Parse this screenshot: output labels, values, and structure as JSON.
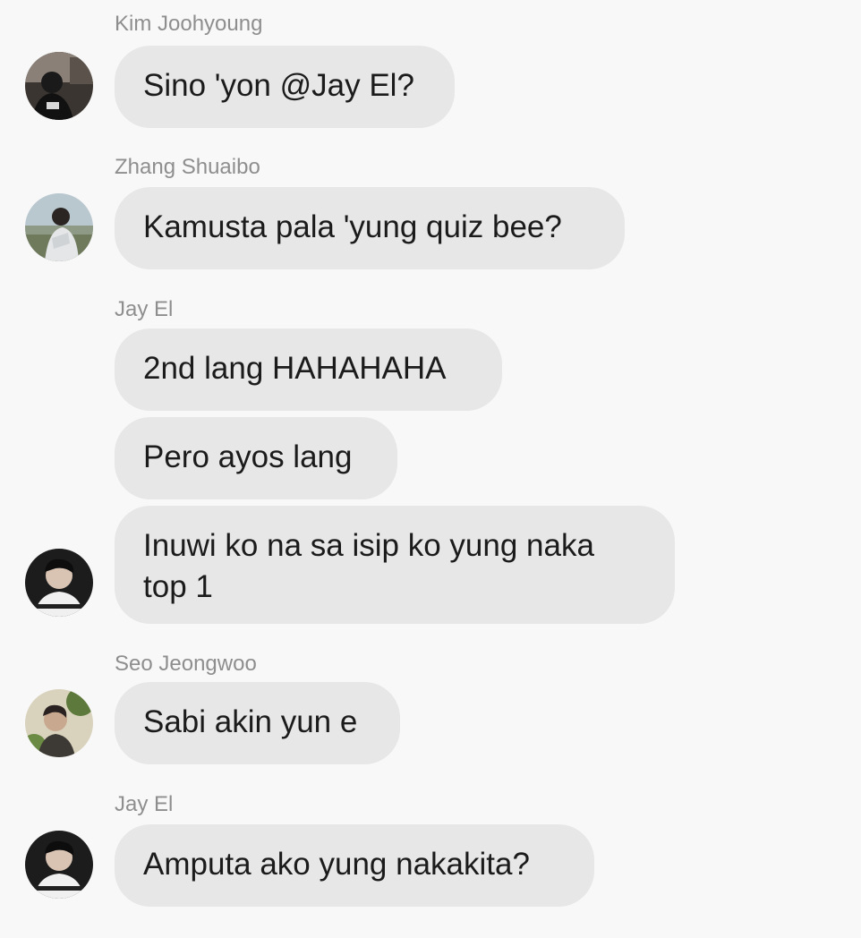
{
  "messages": [
    {
      "sender": "Kim Joohyoung",
      "text": "Sino 'yon @Jay El?"
    },
    {
      "sender": "Zhang Shuaibo",
      "text": "Kamusta pala 'yung quiz bee?"
    },
    {
      "sender": "Jay El",
      "texts": [
        "2nd lang HAHAHAHA",
        "Pero ayos lang",
        "Inuwi ko na sa isip ko yung naka top 1"
      ]
    },
    {
      "sender": "Seo Jeongwoo",
      "text": "Sabi akin yun e"
    },
    {
      "sender": "Jay El",
      "text": "Amputa ako yung nakakita?"
    }
  ],
  "avatars": {
    "kim": "avatar-kim-joohyoung",
    "zhang": "avatar-zhang-shuaibo",
    "jay": "avatar-jay-el",
    "seo": "avatar-seo-jeongwoo"
  },
  "colors": {
    "background": "#f8f8f8",
    "bubble": "#e7e7e7",
    "sender": "#8e8e8e",
    "text": "#1b1b1b"
  }
}
